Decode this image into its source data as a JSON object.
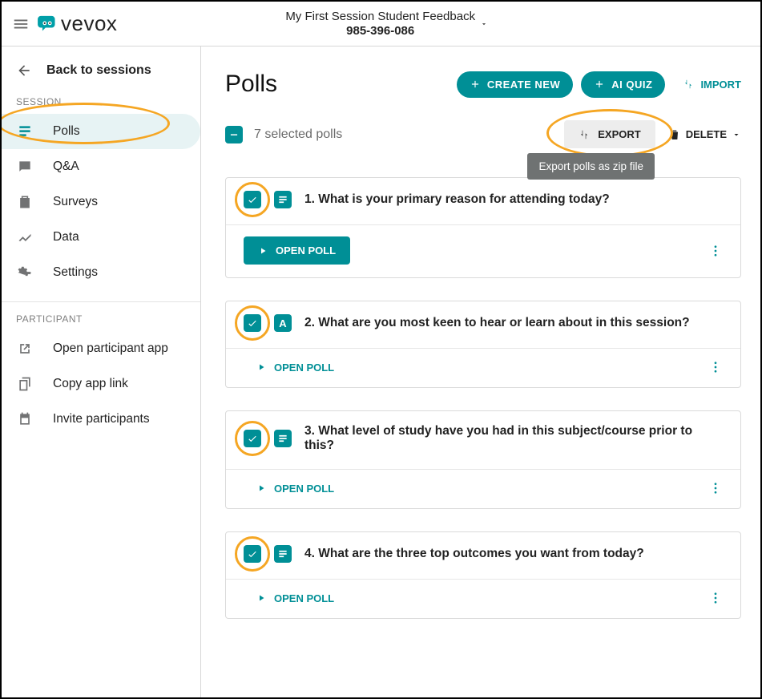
{
  "header": {
    "logo_text": "vevox",
    "title": "My First Session Student Feedback",
    "code": "985-396-086"
  },
  "sidebar": {
    "back": "Back to sessions",
    "section_session": "SESSION",
    "items_session": [
      {
        "label": "Polls"
      },
      {
        "label": "Q&A"
      },
      {
        "label": "Surveys"
      },
      {
        "label": "Data"
      },
      {
        "label": "Settings"
      }
    ],
    "section_participant": "PARTICIPANT",
    "items_participant": [
      {
        "label": "Open participant app"
      },
      {
        "label": "Copy app link"
      },
      {
        "label": "Invite participants"
      }
    ]
  },
  "page": {
    "title": "Polls",
    "create_new": "CREATE NEW",
    "ai_quiz": "AI QUIZ",
    "import": "IMPORT"
  },
  "toolbar": {
    "selected_text": "7 selected polls",
    "export": "EXPORT",
    "export_tooltip": "Export polls as zip file",
    "delete": "DELETE"
  },
  "polls": [
    {
      "q": "1. What is your primary reason for attending today?",
      "type": "list",
      "open_label": "OPEN POLL",
      "open_style": "pill"
    },
    {
      "q": "2. What are you most keen to hear or learn about in this session?",
      "type": "A",
      "open_label": "OPEN POLL",
      "open_style": "link"
    },
    {
      "q": "3. What level of study have you had in this subject/course prior to this?",
      "type": "list",
      "open_label": "OPEN POLL",
      "open_style": "link"
    },
    {
      "q": "4. What are the three top outcomes you want from today?",
      "type": "list",
      "open_label": "OPEN POLL",
      "open_style": "link"
    }
  ]
}
